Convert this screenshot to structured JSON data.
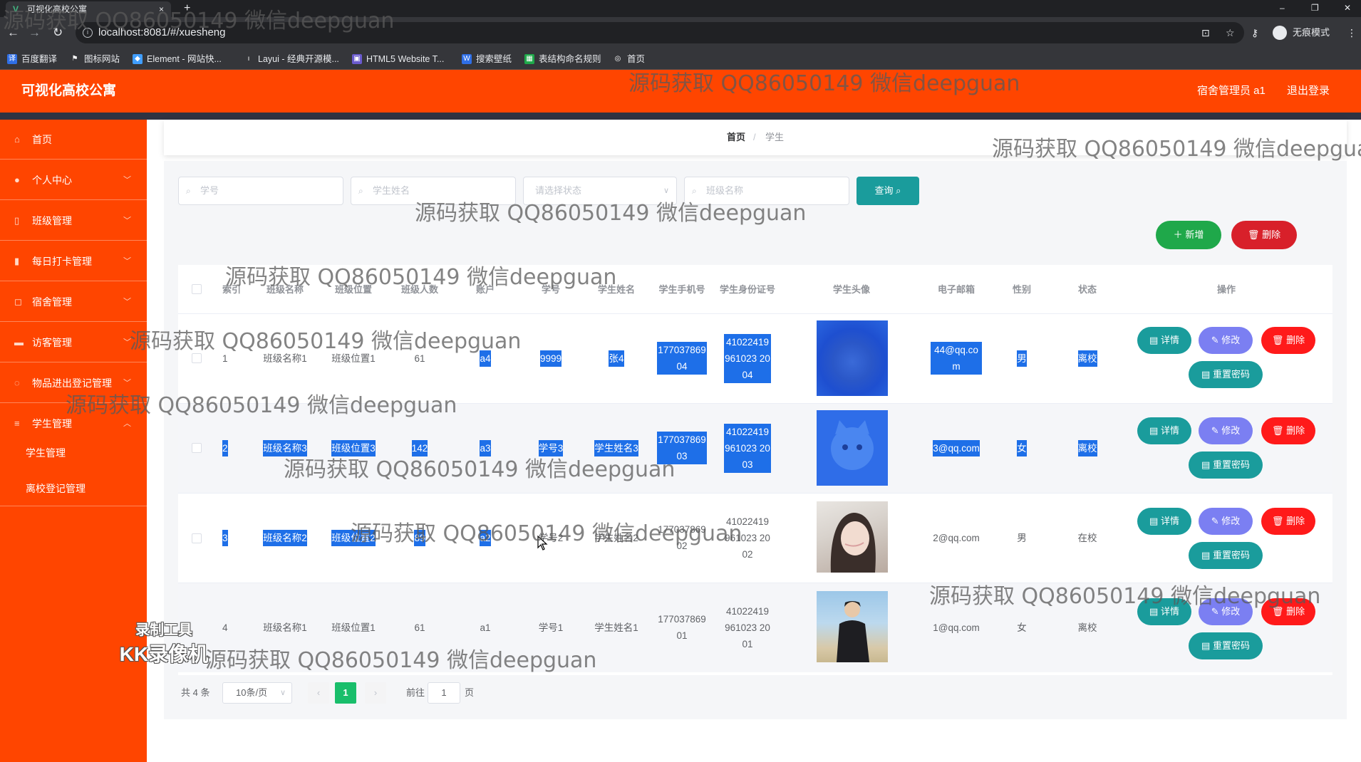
{
  "browser": {
    "tab_title": "可视化高校公寓",
    "tab_close": "×",
    "new_tab": "+",
    "url": "localhost:8081/#/xuesheng",
    "incognito_label": "无痕模式",
    "window_controls": [
      "–",
      "❐",
      "✕"
    ],
    "bookmarks": [
      "百度翻译",
      "图标网站",
      "Element - 网站快...",
      "Layui - 经典开源模...",
      "HTML5 Website T...",
      "搜索壁纸",
      "表结构命名规则",
      "首页"
    ]
  },
  "header": {
    "brand": "可视化高校公寓",
    "user": "宿舍管理员 a1",
    "logout": "退出登录"
  },
  "sidebar": {
    "items": [
      {
        "label": "首页",
        "icon": "home-icon",
        "glyph": "⌂",
        "arrow": ""
      },
      {
        "label": "个人中心",
        "icon": "user-icon",
        "glyph": "●",
        "arrow": "﹀"
      },
      {
        "label": "班级管理",
        "icon": "mobile-icon",
        "glyph": "▯",
        "arrow": "﹀"
      },
      {
        "label": "每日打卡管理",
        "icon": "bar-chart-icon",
        "glyph": "▮",
        "arrow": "﹀"
      },
      {
        "label": "宿舍管理",
        "icon": "copy-icon",
        "glyph": "◻",
        "arrow": "﹀"
      },
      {
        "label": "访客管理",
        "icon": "monitor-icon",
        "glyph": "▬",
        "arrow": "﹀"
      },
      {
        "label": "物品进出登记管理",
        "icon": "refresh-icon",
        "glyph": "◌",
        "arrow": "﹀"
      },
      {
        "label": "学生管理",
        "icon": "list-icon",
        "glyph": "≡",
        "arrow": "︿"
      }
    ],
    "subitems": [
      "学生管理",
      "离校登记管理"
    ]
  },
  "breadcrumb": {
    "home": "首页",
    "sep": "/",
    "current": "学生"
  },
  "filters": {
    "student_no": "学号",
    "student_name": "学生姓名",
    "status": "请选择状态",
    "class_name": "班级名称",
    "query": "查询"
  },
  "actions": {
    "add": "新增",
    "delete": "删除"
  },
  "table": {
    "headers": [
      "索引",
      "班级名称",
      "班级位置",
      "班级人数",
      "账户",
      "学号",
      "学生姓名",
      "学生手机号",
      "学生身份证号",
      "学生头像",
      "电子邮箱",
      "性别",
      "状态",
      "操作"
    ],
    "rows": [
      {
        "index": "1",
        "class_name": "班级名称1",
        "class_pos": "班级位置1",
        "count": "61",
        "account": "a4",
        "no": "9999",
        "name": "张4",
        "phone": "17703786904",
        "idcard": "41022419961023 2004",
        "email": "44@qq.com",
        "gender": "男",
        "status": "离校"
      },
      {
        "index": "2",
        "class_name": "班级名称3",
        "class_pos": "班级位置3",
        "count": "142",
        "account": "a3",
        "no": "学号3",
        "name": "学生姓名3",
        "phone": "17703786903",
        "idcard": "41022419961023 2003",
        "email": "3@qq.com",
        "gender": "女",
        "status": "离校"
      },
      {
        "index": "3",
        "class_name": "班级名称2",
        "class_pos": "班级位置2",
        "count": "89",
        "account": "a2",
        "no": "学号2",
        "name": "学生姓名2",
        "phone": "17703786902",
        "idcard": "41022419961023 2002",
        "email": "2@qq.com",
        "gender": "男",
        "status": "在校"
      },
      {
        "index": "4",
        "class_name": "班级名称1",
        "class_pos": "班级位置1",
        "count": "61",
        "account": "a1",
        "no": "学号1",
        "name": "学生姓名1",
        "phone": "17703786901",
        "idcard": "41022419961023 2001",
        "email": "1@qq.com",
        "gender": "女",
        "status": "离校"
      }
    ],
    "row_actions": {
      "detail": "详情",
      "edit": "修改",
      "delete": "删除",
      "reset": "重置密码"
    }
  },
  "pagination": {
    "total": "共 4 条",
    "page_size": "10条/页",
    "current": "1",
    "goto_prefix": "前往",
    "goto_value": "1",
    "goto_suffix": "页"
  },
  "watermark": "源码获取 QQ86050149 微信deepguan",
  "recorder": {
    "line1": "录制工具",
    "line2": "KK录像机"
  },
  "colors": {
    "primary": "#ff4500",
    "teal": "#1a9c9c",
    "green": "#1fa84a",
    "red": "#d8202a",
    "purple": "#7b7ff2",
    "selection": "#1e6fe8"
  }
}
